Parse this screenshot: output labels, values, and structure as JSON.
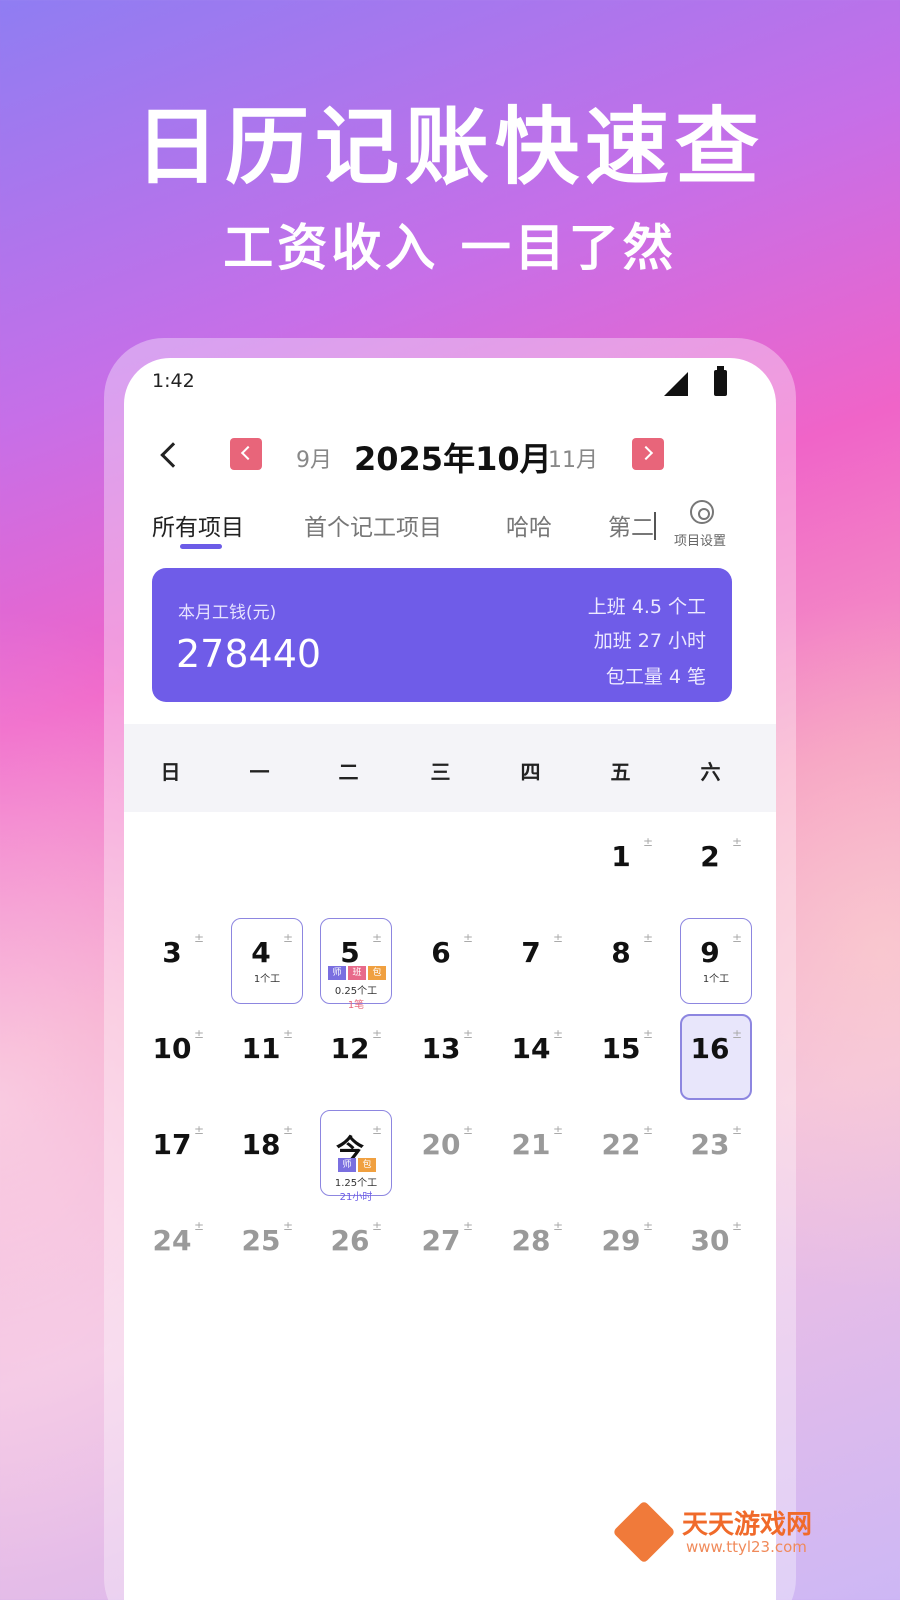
{
  "promo": {
    "headline": "日历记账快速查",
    "subline": "工资收入 一目了然"
  },
  "status_bar": {
    "time": "1:42"
  },
  "month_nav": {
    "prev": "9月",
    "current": "2025年10月",
    "next": "11月"
  },
  "tabs": [
    {
      "label": "所有项目",
      "active": true
    },
    {
      "label": "首个记工项目",
      "active": false
    },
    {
      "label": "哈哈",
      "active": false
    },
    {
      "label": "第二",
      "active": false
    }
  ],
  "settings_label": "项目设置",
  "summary": {
    "label": "本月工钱(元)",
    "value": "278440",
    "stats": [
      "上班 4.5 个工",
      "加班 27 小时",
      "包工量 4 笔"
    ]
  },
  "weekdays": [
    "日",
    "一",
    "二",
    "三",
    "四",
    "五",
    "六"
  ],
  "plus_minus": "±",
  "days": [
    {
      "label": "1",
      "faded": false
    },
    {
      "label": "2",
      "faded": false
    },
    {
      "label": "3",
      "faded": false
    },
    {
      "label": "4",
      "faded": false,
      "line1": "1个工"
    },
    {
      "label": "5",
      "faded": false,
      "tags": [
        "师",
        "班",
        "包"
      ],
      "line1": "0.25个工",
      "line2": "1笔",
      "line2_color": "pink"
    },
    {
      "label": "6",
      "faded": false
    },
    {
      "label": "7",
      "faded": false
    },
    {
      "label": "8",
      "faded": false
    },
    {
      "label": "9",
      "faded": false,
      "line1": "1个工"
    },
    {
      "label": "10",
      "faded": false
    },
    {
      "label": "11",
      "faded": false
    },
    {
      "label": "12",
      "faded": false
    },
    {
      "label": "13",
      "faded": false
    },
    {
      "label": "14",
      "faded": false
    },
    {
      "label": "15",
      "faded": false
    },
    {
      "label": "16",
      "faded": false,
      "selected": true
    },
    {
      "label": "17",
      "faded": false
    },
    {
      "label": "18",
      "faded": false
    },
    {
      "label": "今",
      "faded": false,
      "tags": [
        "师",
        "包"
      ],
      "line1": "1.25个工",
      "line2": "21小时",
      "line2_color": "purple"
    },
    {
      "label": "20",
      "faded": true
    },
    {
      "label": "21",
      "faded": true
    },
    {
      "label": "22",
      "faded": true
    },
    {
      "label": "23",
      "faded": true
    },
    {
      "label": "24",
      "faded": true
    },
    {
      "label": "25",
      "faded": true
    },
    {
      "label": "26",
      "faded": true
    },
    {
      "label": "27",
      "faded": true
    },
    {
      "label": "28",
      "faded": true
    },
    {
      "label": "29",
      "faded": true
    },
    {
      "label": "30",
      "faded": true
    }
  ],
  "watermark": {
    "name": "天天游戏网",
    "url": "www.ttyl23.com"
  }
}
